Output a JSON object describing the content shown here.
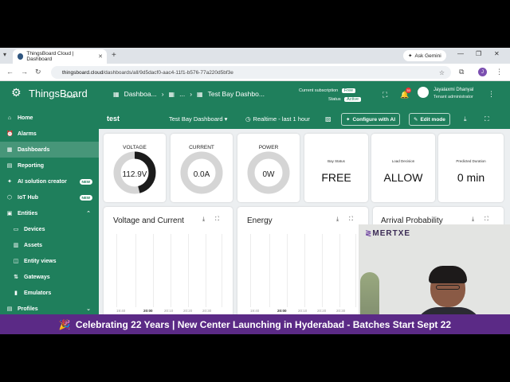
{
  "browser": {
    "tab_title": "ThingsBoard Cloud | Dashboard",
    "url_host": "thingsboard.cloud",
    "url_path": "/dashboards/all/9d5dacf0-aac4-11f1-b576-77a220d5bf3e",
    "gemini_label": "Ask Gemini",
    "profile_initial": "J"
  },
  "header": {
    "logo_text": "ThingsBoard",
    "logo_sub": "Cloud",
    "crumb_1": "Dashboa...",
    "crumb_2": "...",
    "crumb_3": "Test Bay Dashbo...",
    "subscription_label": "Current subscription",
    "subscription_value": "Free",
    "status_label": "Status",
    "status_value": "Active",
    "notification_count": "35",
    "user_name": "Jayalaxmi Dhanyal",
    "user_role": "Tenant administrator"
  },
  "sidebar": {
    "items": [
      {
        "label": "Home",
        "icon": "home-icon"
      },
      {
        "label": "Alarms",
        "icon": "alarm-icon"
      },
      {
        "label": "Dashboards",
        "icon": "dashboard-icon"
      },
      {
        "label": "Reporting",
        "icon": "report-icon"
      },
      {
        "label": "AI solution creator",
        "icon": "ai-icon",
        "badge": "NEW"
      },
      {
        "label": "IoT Hub",
        "icon": "hub-icon",
        "badge": "NEW"
      },
      {
        "label": "Entities",
        "icon": "entities-icon"
      },
      {
        "label": "Devices",
        "icon": "devices-icon"
      },
      {
        "label": "Assets",
        "icon": "assets-icon"
      },
      {
        "label": "Entity views",
        "icon": "entity-views-icon"
      },
      {
        "label": "Gateways",
        "icon": "gateway-icon"
      },
      {
        "label": "Emulators",
        "icon": "emulator-icon"
      },
      {
        "label": "Profiles",
        "icon": "profiles-icon"
      }
    ]
  },
  "dashbar": {
    "title": "test",
    "dashboard_select": "Test Bay Dashboard",
    "time_window": "Realtime - last 1 hour",
    "configure_ai": "Configure with AI",
    "edit_mode": "Edit mode"
  },
  "widgets": {
    "voltage": {
      "label": "VOLTAGE",
      "value": "112.9V",
      "fill": 0.46
    },
    "current": {
      "label": "CURRENT",
      "value": "0.0A",
      "fill": 0
    },
    "power": {
      "label": "POWER",
      "value": "0W",
      "fill": 0
    },
    "bay_status": {
      "label": "Bay Status",
      "value": "FREE"
    },
    "load_decision": {
      "label": "Load Decision",
      "value": "ALLOW"
    },
    "predicted_duration": {
      "label": "Predicted Duration",
      "value": "0 min"
    },
    "chart_voltage_current": {
      "title": "Voltage and Current",
      "ticks": [
        "19:40",
        "20:00",
        "20:10",
        "20:20",
        "20:30"
      ]
    },
    "chart_energy": {
      "title": "Energy",
      "ticks": [
        "19:40",
        "20:00",
        "20:10",
        "20:20",
        "20:30"
      ]
    },
    "chart_arrival": {
      "title": "Arrival Probability"
    }
  },
  "overlay": {
    "brand": "MERTXE",
    "banner": "Celebrating 22 Years | New Center Launching in Hyderabad - Batches Start Sept 22",
    "banner_emoji": "🎉"
  }
}
